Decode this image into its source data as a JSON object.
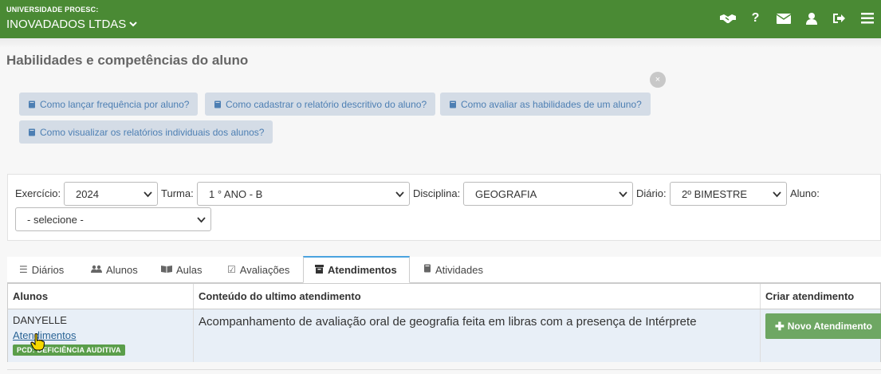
{
  "header": {
    "university": "UNIVERSIDADE PROESC:",
    "company": "INOVADADOS LTDAS",
    "icons": [
      "handshake-icon",
      "question-icon",
      "envelope-icon",
      "user-icon",
      "sign-out-icon",
      "menu-icon"
    ]
  },
  "page": {
    "title": "Habilidades e competências do aluno"
  },
  "help_links": [
    {
      "label": "Como lançar frequência por aluno?"
    },
    {
      "label": "Como cadastrar o relatório descritivo do aluno?"
    },
    {
      "label": "Como avaliar as habilidades de um aluno?"
    },
    {
      "label": "Como visualizar os relatórios individuais dos alunos?"
    }
  ],
  "close_label": "×",
  "filters": {
    "exercicio": {
      "label": "Exercício:",
      "value": "2024"
    },
    "turma": {
      "label": "Turma:",
      "value": "1 ° ANO - B"
    },
    "disciplina": {
      "label": "Disciplina:",
      "value": "GEOGRAFIA"
    },
    "diario": {
      "label": "Diário:",
      "value": "2º BIMESTRE"
    },
    "aluno": {
      "label": "Aluno:",
      "value": "- selecione -"
    }
  },
  "tabs": [
    {
      "label": "Diários",
      "icon": "list-icon"
    },
    {
      "label": "Alunos",
      "icon": "users-icon"
    },
    {
      "label": "Aulas",
      "icon": "book-open-icon"
    },
    {
      "label": "Avaliações",
      "icon": "check-square-icon"
    },
    {
      "label": "Atendimentos",
      "icon": "archive-icon",
      "active": true
    },
    {
      "label": "Atividades",
      "icon": "book-icon"
    }
  ],
  "table": {
    "headers": [
      "Alunos",
      "Conteúdo do ultimo atendimento",
      "Criar atendimento"
    ],
    "rows": [
      {
        "student": "DANYELLE",
        "link": "Atendimentos",
        "badge": "PCD: DEFICIÊNCIA AUDITIVA",
        "content": "Acompanhamento de avaliação oral de geografia feita em libras com a presença de Intérprete",
        "action": "Novo Atendimento"
      }
    ]
  },
  "colors": {
    "header_bg": "#4a8a34",
    "help_bg": "#d4dce6",
    "help_text": "#4d7fb3",
    "active_tab_accent": "#4aa3df",
    "row_bg": "#e8eff7",
    "button_green": "#6ea763"
  }
}
